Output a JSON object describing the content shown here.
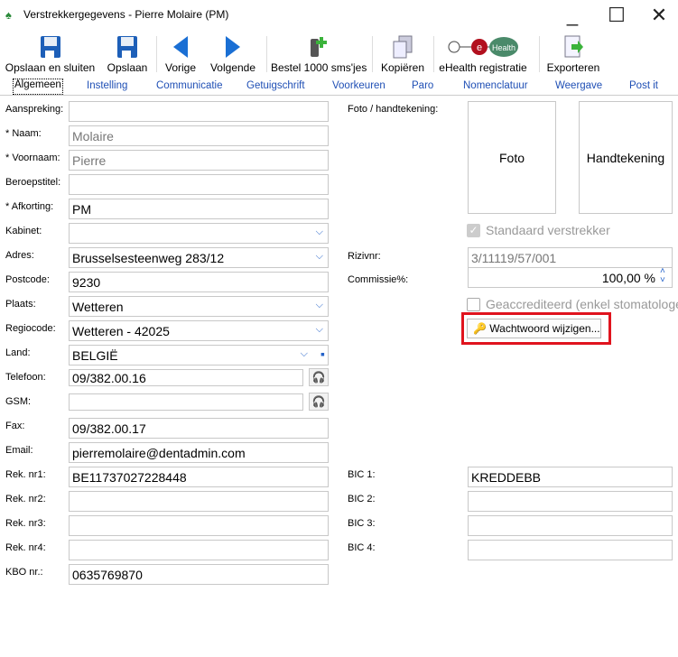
{
  "window": {
    "title": "Verstrekkergegevens - Pierre Molaire (PM)"
  },
  "toolbar": [
    {
      "label": "Opslaan en sluiten",
      "icon": "floppy-icon"
    },
    {
      "label": "Opslaan",
      "icon": "floppy-icon"
    },
    {
      "label": "Vorige",
      "icon": "arrow-left-icon"
    },
    {
      "label": "Volgende",
      "icon": "arrow-right-icon"
    },
    {
      "label": "Bestel 1000 sms'jes",
      "icon": "phone-add-icon"
    },
    {
      "label": "Kopiëren",
      "icon": "copy-icon"
    },
    {
      "label": "eHealth registratie",
      "icon": "ehealth-icon",
      "logo_text": "Health"
    },
    {
      "label": "Exporteren",
      "icon": "export-icon"
    }
  ],
  "tabs": [
    "Algemeen",
    "Instelling",
    "Communicatie",
    "Getuigschrift",
    "Voorkeuren",
    "Paro",
    "Nomenclatuur",
    "Weergave",
    "Post it"
  ],
  "left_fields": [
    {
      "label": "Aanspreking:",
      "value": ""
    },
    {
      "label": "* Naam:",
      "value": "Molaire",
      "gray": true
    },
    {
      "label": "* Voornaam:",
      "value": "Pierre",
      "gray": true
    },
    {
      "label": "Beroepstitel:",
      "value": ""
    },
    {
      "label": "* Afkorting:",
      "value": "PM"
    },
    {
      "label": "Kabinet:",
      "value": "",
      "dropdown": true
    },
    {
      "label": "Adres:",
      "value": "Brusselsesteenweg 283/12",
      "dropdown": true
    },
    {
      "label": "Postcode:",
      "value": "9230"
    },
    {
      "label": "Plaats:",
      "value": "Wetteren",
      "dropdown": true
    },
    {
      "label": "Regiocode:",
      "value": "Wetteren - 42025",
      "dropdown": true
    },
    {
      "label": "Land:",
      "value": "BELGIË",
      "dropdown": true,
      "save": true
    },
    {
      "label": "Telefoon:",
      "value": "09/382.00.16",
      "headset": true
    },
    {
      "label": "GSM:",
      "value": "",
      "headset": true
    },
    {
      "label": "Fax:",
      "value": "09/382.00.17"
    },
    {
      "label": "Email:",
      "value": "pierremolaire@dentadmin.com"
    },
    {
      "label": "Rek. nr1:",
      "value": "BE11737027228448"
    },
    {
      "label": "Rek. nr2:",
      "value": ""
    },
    {
      "label": "Rek. nr3:",
      "value": ""
    },
    {
      "label": "Rek. nr4:",
      "value": ""
    },
    {
      "label": "KBO nr.:",
      "value": "0635769870"
    }
  ],
  "right": {
    "foto_label": "Foto / handtekening:",
    "foto": "Foto",
    "handtekening": "Handtekening",
    "standaard": {
      "label": "Standaard verstrekker",
      "checked": true
    },
    "rizivnr_label": "Rizivnr:",
    "rizivnr": "3/11119/57/001",
    "commissie_label": "Commissie%:",
    "commissie": "100,00 %",
    "geaccrediteerd": {
      "label": "Geaccrediteerd (enkel stomatologen)",
      "checked": false
    },
    "password_button": "Wachtwoord wijzigen...",
    "bic": [
      {
        "label": "BIC 1:",
        "value": "KREDDEBB"
      },
      {
        "label": "BIC 2:",
        "value": ""
      },
      {
        "label": "BIC 3:",
        "value": ""
      },
      {
        "label": "BIC 4:",
        "value": ""
      }
    ]
  },
  "colors": {
    "highlight": "#e0141e",
    "link": "#1f4fb5",
    "accent": "#2563c9"
  }
}
